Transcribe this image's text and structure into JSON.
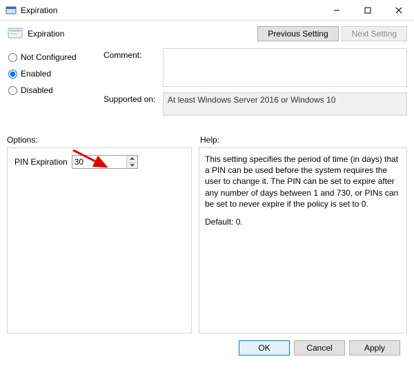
{
  "window": {
    "title": "Expiration"
  },
  "header": {
    "policy_name": "Expiration",
    "prev_label": "Previous Setting",
    "next_label": "Next Setting"
  },
  "state": {
    "not_configured_label": "Not Configured",
    "enabled_label": "Enabled",
    "disabled_label": "Disabled",
    "selected": "enabled"
  },
  "comment": {
    "label": "Comment:",
    "value": ""
  },
  "supported": {
    "label": "Supported on:",
    "value": "At least Windows Server 2016 or Windows 10"
  },
  "sections": {
    "options_label": "Options:",
    "help_label": "Help:"
  },
  "options": {
    "pin_expiration": {
      "label": "PIN Expiration",
      "value": "30"
    }
  },
  "help": {
    "body": "This setting specifies the period of time (in days) that a PIN can be used before the system requires the user to change it. The PIN can be set to expire after any number of days between 1 and 730, or PINs can be set to never expire if the policy is set to 0.",
    "default_line": "Default: 0."
  },
  "buttons": {
    "ok": "OK",
    "cancel": "Cancel",
    "apply": "Apply"
  }
}
